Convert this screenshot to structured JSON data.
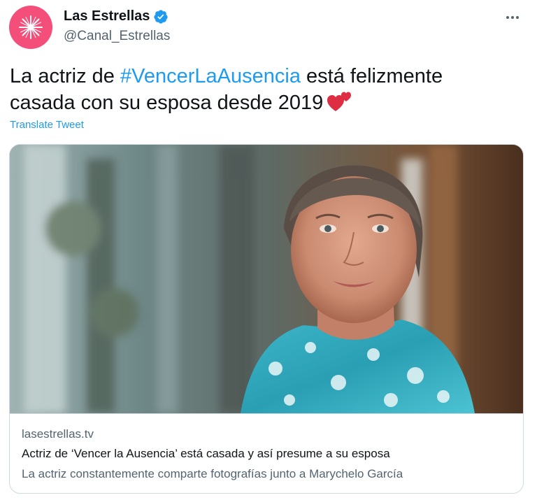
{
  "author": {
    "name": "Las Estrellas",
    "handle": "@Canal_Estrellas",
    "avatar_color": "#f44f7a",
    "verified_color": "#1d9bf0"
  },
  "tweet": {
    "text_before": "La actriz de ",
    "hashtag": "#VencerLaAusencia",
    "text_after": " está felizmente casada con su esposa desde 2019",
    "emoji": "two-hearts-icon",
    "translate_label": "Translate Tweet"
  },
  "card": {
    "domain": "lasestrellas.tv",
    "title": "Actriz de ‘Vencer la Ausencia’ está casada y así presume a su esposa",
    "description": "La actriz constantemente comparte fotografías junto a Marychelo García"
  },
  "colors": {
    "link": "#1d9bf0",
    "secondary_text": "#536471",
    "border": "#cfd9de"
  }
}
